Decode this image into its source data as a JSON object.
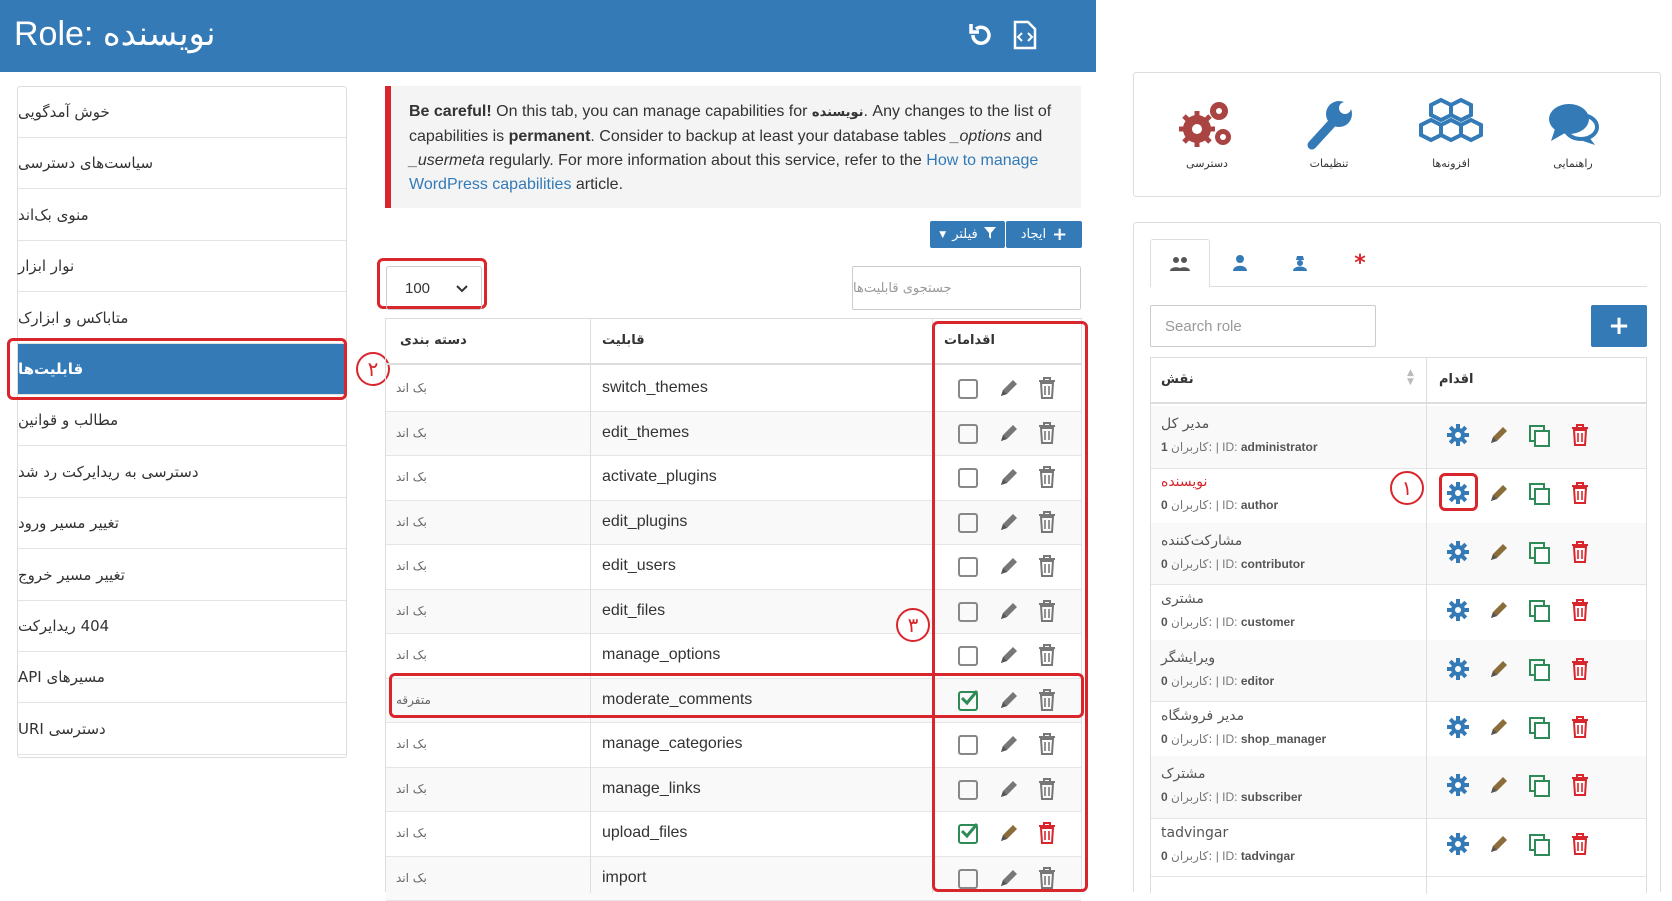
{
  "header": {
    "title": "Role: نویسنده"
  },
  "menu": {
    "items": [
      {
        "label": "خوش آمدگویی"
      },
      {
        "label": "سیاست‌های دسترسی"
      },
      {
        "label": "منوی بک‌اند"
      },
      {
        "label": "نوار ابزار"
      },
      {
        "label": "متاباکس و ابزارک"
      },
      {
        "label": "قابلیت‌ها"
      },
      {
        "label": "مطالب و قوانین"
      },
      {
        "label": "دسترسی به ریدایرکت رد شد"
      },
      {
        "label": "تغییر مسیر ورود"
      },
      {
        "label": "تغییر مسیر خروج"
      },
      {
        "label": "404 ریدایرکت"
      },
      {
        "label": "API مسیرهای"
      },
      {
        "label": "URI دسترسی"
      }
    ],
    "active_index": 5
  },
  "warning": {
    "strong1": "Be careful!",
    "t1": " On this tab, you can manage capabilities for ",
    "role": "نویسنده",
    "t2": ". Any changes to the list of capabilities is ",
    "strong2": "permanent",
    "t3": ". Consider to backup at least your database tables ",
    "em1": "_options",
    "t4": " and ",
    "em2": "_usermeta",
    "t5": " regularly. For more information about this service, refer to the ",
    "link": "How to manage WordPress capabilities",
    "t6": " article."
  },
  "toolbar": {
    "create_label": "ایجاد",
    "filter_label": "فیلتر"
  },
  "page_size": {
    "value": "100"
  },
  "cap_search": {
    "placeholder": "جستجوی قابلیت‌ها"
  },
  "cap_table": {
    "headers": {
      "category": "دسته بندی",
      "capability": "قابلیت",
      "actions": "اقدامات"
    },
    "rows": [
      {
        "category": "بک اند",
        "name": "switch_themes",
        "checked": false
      },
      {
        "category": "بک اند",
        "name": "edit_themes",
        "checked": false
      },
      {
        "category": "بک اند",
        "name": "activate_plugins",
        "checked": false
      },
      {
        "category": "بک اند",
        "name": "edit_plugins",
        "checked": false
      },
      {
        "category": "بک اند",
        "name": "edit_users",
        "checked": false
      },
      {
        "category": "بک اند",
        "name": "edit_files",
        "checked": false
      },
      {
        "category": "بک اند",
        "name": "manage_options",
        "checked": false
      },
      {
        "category": "متفرقه",
        "name": "moderate_comments",
        "checked": true
      },
      {
        "category": "بک اند",
        "name": "manage_categories",
        "checked": false
      },
      {
        "category": "بک اند",
        "name": "manage_links",
        "checked": false
      },
      {
        "category": "بک اند",
        "name": "upload_files",
        "checked": true
      },
      {
        "category": "بک اند",
        "name": "import",
        "checked": false
      }
    ]
  },
  "annotations": {
    "one": "١",
    "two": "٢",
    "three": "٣"
  },
  "tools": [
    {
      "label": "دسترسی",
      "icon": "gears-icon"
    },
    {
      "label": "تنظیمات",
      "icon": "wrench-icon"
    },
    {
      "label": "افزونه‌ها",
      "icon": "cubes-icon"
    },
    {
      "label": "راهنمایی",
      "icon": "chat-icon"
    }
  ],
  "role_search": {
    "placeholder": "Search role"
  },
  "role_table": {
    "headers": {
      "role": "نقش",
      "action": "اقدام"
    },
    "users_label": "کاربران:",
    "rows": [
      {
        "name": "مدیر کل",
        "count": "1",
        "id": "administrator",
        "highlight": false
      },
      {
        "name": "نویسنده",
        "count": "0",
        "id": "author",
        "highlight": true
      },
      {
        "name": "مشارکت‌کننده",
        "count": "0",
        "id": "contributor",
        "highlight": false
      },
      {
        "name": "مشتری",
        "count": "0",
        "id": "customer",
        "highlight": false
      },
      {
        "name": "ویرایشگر",
        "count": "0",
        "id": "editor",
        "highlight": false
      },
      {
        "name": "مدیر فروشگاه",
        "count": "0",
        "id": "shop_manager",
        "highlight": false
      },
      {
        "name": "مشترک",
        "count": "0",
        "id": "subscriber",
        "highlight": false
      },
      {
        "name": "tadvingar",
        "count": "0",
        "id": "tadvingar",
        "highlight": false
      }
    ]
  },
  "colors": {
    "primary": "#337ab7",
    "danger": "#d9262c",
    "success": "#2e8b57",
    "pencil": "#8a6d3b"
  }
}
